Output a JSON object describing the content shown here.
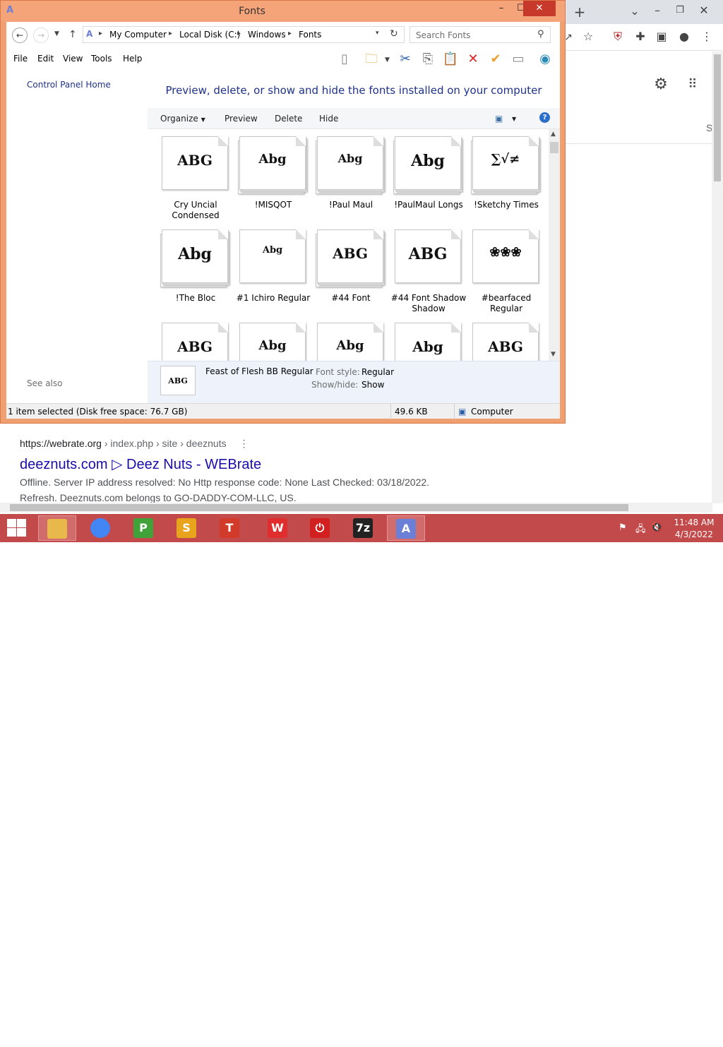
{
  "window": {
    "title": "Fonts",
    "minimize": "–",
    "maximize": "☐",
    "close": "✕"
  },
  "address": {
    "breadcrumbs": [
      "My Computer",
      "Local Disk (C:)",
      "Windows",
      "Fonts"
    ],
    "search_placeholder": "Search Fonts"
  },
  "menu": [
    "File",
    "Edit",
    "View",
    "Tools",
    "Help"
  ],
  "left_pane": {
    "home_link": "Control Panel Home",
    "see_also": "See also"
  },
  "main": {
    "heading": "Preview, delete, or show and hide the fonts installed on your computer",
    "commands": {
      "organize": "Organize",
      "preview": "Preview",
      "delete": "Delete",
      "hide": "Hide"
    }
  },
  "fonts": [
    {
      "name_line1": "Cry Uncial",
      "name_line2": "Condensed",
      "sample": "ABG",
      "stacked": false
    },
    {
      "name_line1": "!MISQOT",
      "name_line2": "",
      "sample": "Abg",
      "stacked": true
    },
    {
      "name_line1": "!Paul Maul",
      "name_line2": "",
      "sample": "Abg",
      "stacked": true
    },
    {
      "name_line1": "!PaulMaul Longs",
      "name_line2": "",
      "sample": "Abg",
      "stacked": true
    },
    {
      "name_line1": "!Sketchy Times",
      "name_line2": "",
      "sample": "∑√≠",
      "stacked": true
    },
    {
      "name_line1": "!The Bloc",
      "name_line2": "",
      "sample": "Abg",
      "stacked": true
    },
    {
      "name_line1": "#1 Ichiro Regular",
      "name_line2": "",
      "sample": "Abg",
      "stacked": false
    },
    {
      "name_line1": "#44 Font",
      "name_line2": "",
      "sample": "ABG",
      "stacked": true
    },
    {
      "name_line1": "#44 Font Shadow",
      "name_line2": "Shadow",
      "sample": "ABG",
      "stacked": false
    },
    {
      "name_line1": "#bearfaced",
      "name_line2": "Regular",
      "sample": "❀❀❀",
      "stacked": false
    },
    {
      "name_line1": "",
      "name_line2": "",
      "sample": "ABG",
      "stacked": false
    },
    {
      "name_line1": "",
      "name_line2": "",
      "sample": "Abg",
      "stacked": false
    },
    {
      "name_line1": "",
      "name_line2": "",
      "sample": "Abg",
      "stacked": false
    },
    {
      "name_line1": "",
      "name_line2": "",
      "sample": "Abg",
      "stacked": false
    },
    {
      "name_line1": "",
      "name_line2": "",
      "sample": "ABG",
      "stacked": false
    }
  ],
  "details": {
    "thumb_sample": "ABG",
    "font_name": "Feast of Flesh BB Regular",
    "style_label": "Font style:",
    "style_value": "Regular",
    "showhide_label": "Show/hide:",
    "showhide_value": "Show"
  },
  "status": {
    "selection": "1 item selected (Disk free space: 76.7 GB)",
    "size": "49.6 KB",
    "location": "Computer"
  },
  "browser": {
    "result_url_host": "https://webrate.org",
    "result_url_path": " › index.php › site › deeznuts",
    "result_title": "deeznuts.com ▷ Deez Nuts - WEBrate",
    "snippet1": "Offline. Server IP address resolved: No Http response code: None Last Checked: 03/18/2022.",
    "snippet2": "Refresh. Deeznuts.com belongs to GO-DADDY-COM-LLC, US.",
    "side_letter": "S"
  },
  "taskbar": {
    "apps": [
      {
        "name": "file-explorer",
        "label": "",
        "color": "#e8b84a"
      },
      {
        "name": "chrome",
        "label": "",
        "color": "#4285f4"
      },
      {
        "name": "wps-presentation",
        "label": "P",
        "color": "#3fa33a"
      },
      {
        "name": "wps-spreadsheet",
        "label": "S",
        "color": "#e8a41c"
      },
      {
        "name": "wps-writer",
        "label": "T",
        "color": "#d23a2a"
      },
      {
        "name": "wps-office",
        "label": "W",
        "color": "#e02d2d"
      },
      {
        "name": "power-app",
        "label": "⏻",
        "color": "#d21f1f"
      },
      {
        "name": "7zip",
        "label": "7z",
        "color": "#222222"
      },
      {
        "name": "fonts-app",
        "label": "A",
        "color": "#6b7fd6"
      }
    ],
    "time": "11:48 AM",
    "date": "4/3/2022"
  }
}
